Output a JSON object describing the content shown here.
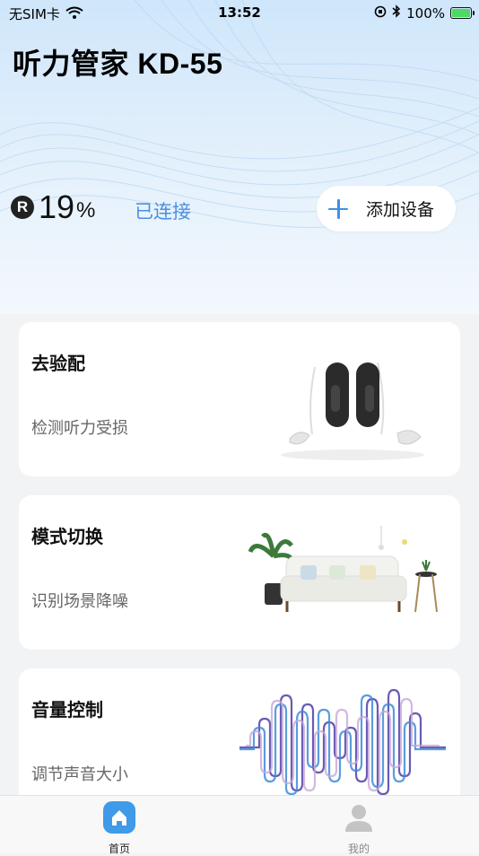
{
  "status_bar": {
    "carrier": "无SIM卡",
    "time": "13:52",
    "battery": "100%"
  },
  "device": {
    "title": "听力管家 KD-55",
    "side_badge": "R",
    "battery_value": "19",
    "battery_unit": "%",
    "connection_status": "已连接"
  },
  "add_device": {
    "label": "添加设备"
  },
  "cards": [
    {
      "title": "去验配",
      "subtitle": "检测听力受损",
      "icon": "hearing-aids-image"
    },
    {
      "title": "模式切换",
      "subtitle": "识别场景降噪",
      "icon": "living-room-image"
    },
    {
      "title": "音量控制",
      "subtitle": "调节声音大小",
      "icon": "sound-wave-image"
    }
  ],
  "tabbar": {
    "items": [
      {
        "label": "首页",
        "icon": "home-icon",
        "active": true
      },
      {
        "label": "我的",
        "icon": "user-icon",
        "active": false
      }
    ]
  },
  "colors": {
    "accent": "#3f8fe6",
    "connected": "#4a90e2",
    "tab_active": "#3f9ae8"
  }
}
